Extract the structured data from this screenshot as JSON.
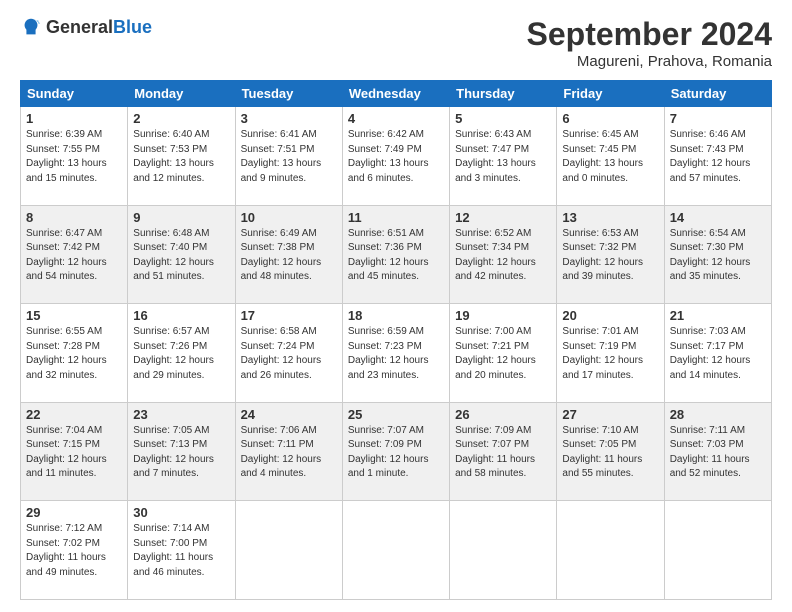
{
  "header": {
    "logo_general": "General",
    "logo_blue": "Blue",
    "title": "September 2024",
    "location": "Magureni, Prahova, Romania"
  },
  "weekdays": [
    "Sunday",
    "Monday",
    "Tuesday",
    "Wednesday",
    "Thursday",
    "Friday",
    "Saturday"
  ],
  "weeks": [
    [
      {
        "day": "1",
        "detail": "Sunrise: 6:39 AM\nSunset: 7:55 PM\nDaylight: 13 hours\nand 15 minutes."
      },
      {
        "day": "2",
        "detail": "Sunrise: 6:40 AM\nSunset: 7:53 PM\nDaylight: 13 hours\nand 12 minutes."
      },
      {
        "day": "3",
        "detail": "Sunrise: 6:41 AM\nSunset: 7:51 PM\nDaylight: 13 hours\nand 9 minutes."
      },
      {
        "day": "4",
        "detail": "Sunrise: 6:42 AM\nSunset: 7:49 PM\nDaylight: 13 hours\nand 6 minutes."
      },
      {
        "day": "5",
        "detail": "Sunrise: 6:43 AM\nSunset: 7:47 PM\nDaylight: 13 hours\nand 3 minutes."
      },
      {
        "day": "6",
        "detail": "Sunrise: 6:45 AM\nSunset: 7:45 PM\nDaylight: 13 hours\nand 0 minutes."
      },
      {
        "day": "7",
        "detail": "Sunrise: 6:46 AM\nSunset: 7:43 PM\nDaylight: 12 hours\nand 57 minutes."
      }
    ],
    [
      {
        "day": "8",
        "detail": "Sunrise: 6:47 AM\nSunset: 7:42 PM\nDaylight: 12 hours\nand 54 minutes."
      },
      {
        "day": "9",
        "detail": "Sunrise: 6:48 AM\nSunset: 7:40 PM\nDaylight: 12 hours\nand 51 minutes."
      },
      {
        "day": "10",
        "detail": "Sunrise: 6:49 AM\nSunset: 7:38 PM\nDaylight: 12 hours\nand 48 minutes."
      },
      {
        "day": "11",
        "detail": "Sunrise: 6:51 AM\nSunset: 7:36 PM\nDaylight: 12 hours\nand 45 minutes."
      },
      {
        "day": "12",
        "detail": "Sunrise: 6:52 AM\nSunset: 7:34 PM\nDaylight: 12 hours\nand 42 minutes."
      },
      {
        "day": "13",
        "detail": "Sunrise: 6:53 AM\nSunset: 7:32 PM\nDaylight: 12 hours\nand 39 minutes."
      },
      {
        "day": "14",
        "detail": "Sunrise: 6:54 AM\nSunset: 7:30 PM\nDaylight: 12 hours\nand 35 minutes."
      }
    ],
    [
      {
        "day": "15",
        "detail": "Sunrise: 6:55 AM\nSunset: 7:28 PM\nDaylight: 12 hours\nand 32 minutes."
      },
      {
        "day": "16",
        "detail": "Sunrise: 6:57 AM\nSunset: 7:26 PM\nDaylight: 12 hours\nand 29 minutes."
      },
      {
        "day": "17",
        "detail": "Sunrise: 6:58 AM\nSunset: 7:24 PM\nDaylight: 12 hours\nand 26 minutes."
      },
      {
        "day": "18",
        "detail": "Sunrise: 6:59 AM\nSunset: 7:23 PM\nDaylight: 12 hours\nand 23 minutes."
      },
      {
        "day": "19",
        "detail": "Sunrise: 7:00 AM\nSunset: 7:21 PM\nDaylight: 12 hours\nand 20 minutes."
      },
      {
        "day": "20",
        "detail": "Sunrise: 7:01 AM\nSunset: 7:19 PM\nDaylight: 12 hours\nand 17 minutes."
      },
      {
        "day": "21",
        "detail": "Sunrise: 7:03 AM\nSunset: 7:17 PM\nDaylight: 12 hours\nand 14 minutes."
      }
    ],
    [
      {
        "day": "22",
        "detail": "Sunrise: 7:04 AM\nSunset: 7:15 PM\nDaylight: 12 hours\nand 11 minutes."
      },
      {
        "day": "23",
        "detail": "Sunrise: 7:05 AM\nSunset: 7:13 PM\nDaylight: 12 hours\nand 7 minutes."
      },
      {
        "day": "24",
        "detail": "Sunrise: 7:06 AM\nSunset: 7:11 PM\nDaylight: 12 hours\nand 4 minutes."
      },
      {
        "day": "25",
        "detail": "Sunrise: 7:07 AM\nSunset: 7:09 PM\nDaylight: 12 hours\nand 1 minute."
      },
      {
        "day": "26",
        "detail": "Sunrise: 7:09 AM\nSunset: 7:07 PM\nDaylight: 11 hours\nand 58 minutes."
      },
      {
        "day": "27",
        "detail": "Sunrise: 7:10 AM\nSunset: 7:05 PM\nDaylight: 11 hours\nand 55 minutes."
      },
      {
        "day": "28",
        "detail": "Sunrise: 7:11 AM\nSunset: 7:03 PM\nDaylight: 11 hours\nand 52 minutes."
      }
    ],
    [
      {
        "day": "29",
        "detail": "Sunrise: 7:12 AM\nSunset: 7:02 PM\nDaylight: 11 hours\nand 49 minutes."
      },
      {
        "day": "30",
        "detail": "Sunrise: 7:14 AM\nSunset: 7:00 PM\nDaylight: 11 hours\nand 46 minutes."
      },
      {
        "day": "",
        "detail": ""
      },
      {
        "day": "",
        "detail": ""
      },
      {
        "day": "",
        "detail": ""
      },
      {
        "day": "",
        "detail": ""
      },
      {
        "day": "",
        "detail": ""
      }
    ]
  ]
}
